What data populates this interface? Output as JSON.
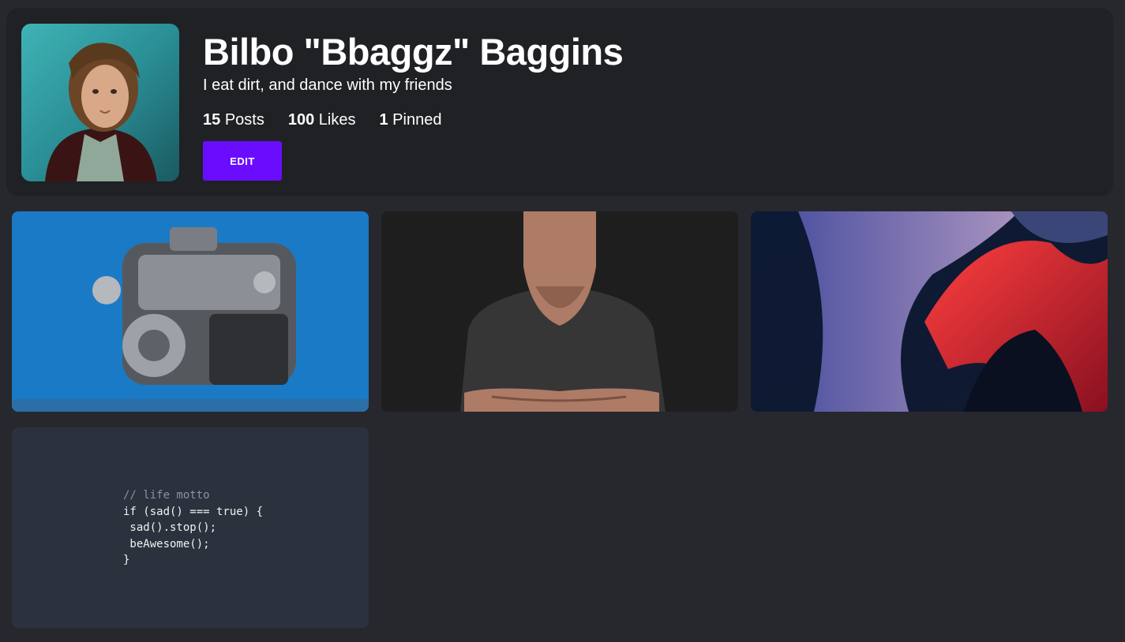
{
  "profile": {
    "name": "Bilbo \"Bbaggz\" Baggins",
    "bio": "I eat dirt, and dance with my friends",
    "avatar_icon": "profile-avatar-photo",
    "stats": [
      {
        "count": "15",
        "label": "Posts"
      },
      {
        "count": "100",
        "label": "Likes"
      },
      {
        "count": "1",
        "label": "Pinned"
      }
    ],
    "edit_label": "EDIT"
  },
  "posts": [
    {
      "kind": "image",
      "subject": "engine"
    },
    {
      "kind": "image",
      "subject": "faceless-person-illustration"
    },
    {
      "kind": "image",
      "subject": "abstract-fluid-art"
    },
    {
      "kind": "code",
      "lines": [
        "// life motto",
        "if (sad() === true) {",
        " sad().stop();",
        " beAwesome();",
        "}"
      ]
    }
  ],
  "colors": {
    "background": "#27282d",
    "card": "#1f2125",
    "accent": "#6a0dff",
    "code_bg": "#2b313d"
  }
}
